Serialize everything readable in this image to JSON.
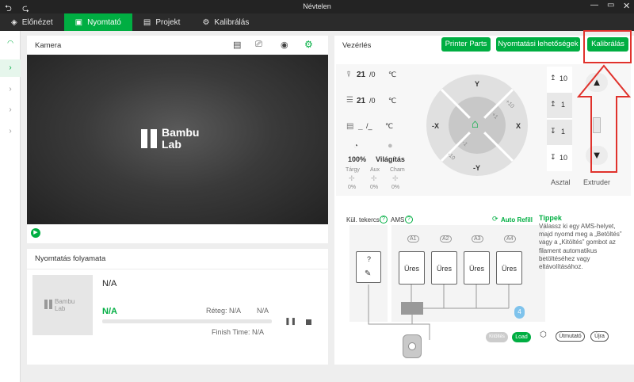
{
  "window": {
    "title": "Névtelen"
  },
  "tabs": [
    {
      "label": "Előnézet"
    },
    {
      "label": "Nyomtató"
    },
    {
      "label": "Projekt"
    },
    {
      "label": "Kalibrálás"
    }
  ],
  "camera": {
    "title": "Kamera",
    "logo_line1": "Bambu",
    "logo_line2": "Lab"
  },
  "progress": {
    "title": "Nyomtatás folyamata",
    "name": "N/A",
    "status": "N/A",
    "layer_label": "Réteg: N/A",
    "layer_value": "N/A",
    "finish": "Finish Time: N/A",
    "thumb_line1": "Bambu",
    "thumb_line2": "Lab",
    "percent": 0
  },
  "control": {
    "title": "Vezérlés",
    "btn_parts": "Printer Parts",
    "btn_options": "Nyomtatási lehetőségek",
    "btn_calib": "Kalibrálás"
  },
  "temps": {
    "nozzle": "21",
    "nozzle_target": "/0",
    "bed": "21",
    "bed_target": "/0",
    "chamber": "_",
    "chamber_target": "/_",
    "unit": "℃"
  },
  "speed": {
    "value": "100%",
    "light": "Világítás"
  },
  "fans": [
    {
      "label": "Tárgy",
      "value": "0%"
    },
    {
      "label": "Aux",
      "value": "0%"
    },
    {
      "label": "Cham",
      "value": "0%"
    }
  ],
  "jog": {
    "y": "Y",
    "ny": "-Y",
    "x": "X",
    "nx": "-X",
    "p10": "+10",
    "p1": "+1",
    "m1": "-1",
    "m10": "-10"
  },
  "z": {
    "up10": "10",
    "up1": "1",
    "down1": "1",
    "down10": "10",
    "label": "Asztal"
  },
  "extruder": {
    "label": "Extruder"
  },
  "ams": {
    "ext_label": "Kül. tekercs",
    "ams_label": "AMS",
    "help": "?",
    "auto_refill": "Auto Refill",
    "ext_slot": "?",
    "slots": [
      {
        "tag": "A1",
        "label": "Üres"
      },
      {
        "tag": "A2",
        "label": "Üres"
      },
      {
        "tag": "A3",
        "label": "Üres"
      },
      {
        "tag": "A4",
        "label": "Üres"
      }
    ],
    "drop_value": "4",
    "btn_unload": "Kitöltés",
    "btn_load": "Load"
  },
  "tips": {
    "title": "Tippek",
    "text": "Válassz ki egy AMS-helyet, majd nyomd meg a „Betöltés” vagy a „Kitöltés” gombot az filament automatikus betöltéséhez vagy eltávolításához.",
    "btn_guide": "Útmutató",
    "btn_retry": "Újra"
  },
  "colors": {
    "accent": "#00ae42",
    "highlight": "#e0322c"
  }
}
